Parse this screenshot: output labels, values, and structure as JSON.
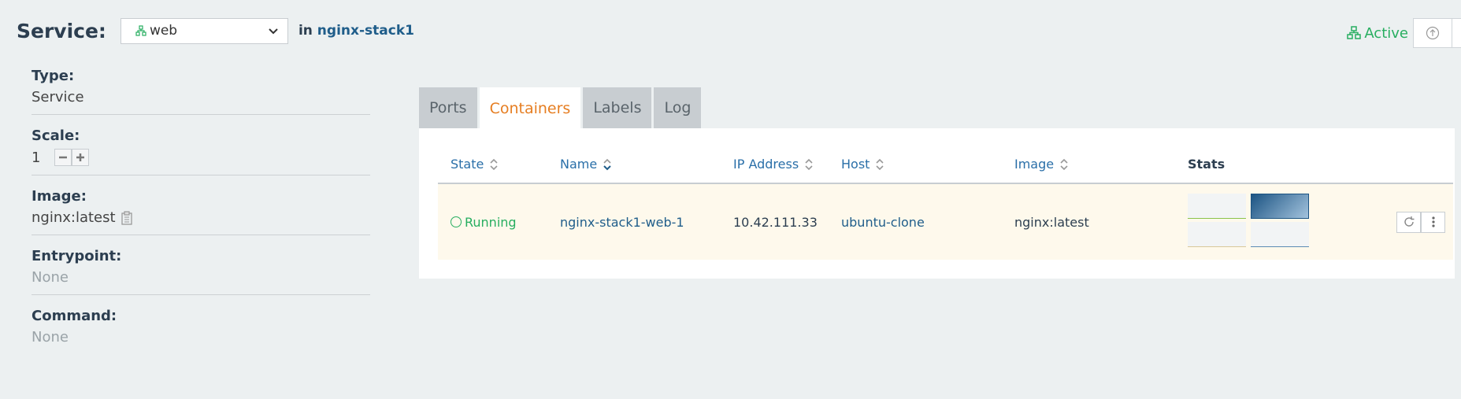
{
  "header": {
    "title": "Service:",
    "service_name": "web",
    "in_label": "in",
    "stack_name": "nginx-stack1"
  },
  "status": {
    "state": "Active",
    "color": "#27ae60"
  },
  "details": {
    "type_label": "Type:",
    "type_value": "Service",
    "scale_label": "Scale:",
    "scale_value": "1",
    "image_label": "Image:",
    "image_value": "nginx:latest",
    "entrypoint_label": "Entrypoint:",
    "entrypoint_value": "None",
    "command_label": "Command:",
    "command_value": "None"
  },
  "tabs": [
    {
      "label": "Ports",
      "active": false
    },
    {
      "label": "Containers",
      "active": true
    },
    {
      "label": "Labels",
      "active": false
    },
    {
      "label": "Log",
      "active": false
    }
  ],
  "table": {
    "headers": {
      "state": "State",
      "name": "Name",
      "ip": "IP Address",
      "host": "Host",
      "image": "Image",
      "stats": "Stats"
    },
    "rows": [
      {
        "state": "Running",
        "name": "nginx-stack1-web-1",
        "ip": "10.42.111.33",
        "host": "ubuntu-clone",
        "image": "nginx:latest"
      }
    ]
  },
  "icons": {
    "service": "service-icon",
    "dropdown": "chevron-down-icon",
    "upgrade": "upgrade-icon",
    "copy": "copy-icon",
    "restart": "restart-icon",
    "more": "more-vertical-icon"
  },
  "colors": {
    "accent": "#e67e22",
    "link": "#1f5d8a",
    "running": "#27ae60",
    "row_highlight": "#fef9ec"
  }
}
